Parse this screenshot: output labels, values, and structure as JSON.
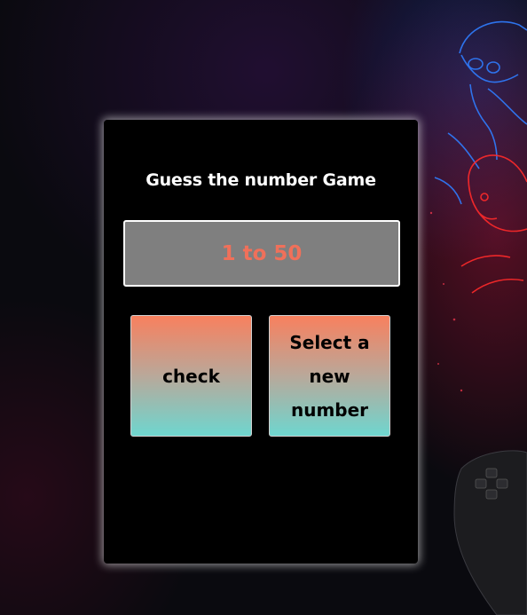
{
  "game": {
    "title": "Guess the number Game",
    "range_text": "1 to 50",
    "check_label": "check",
    "new_number_label": "Select a new number"
  },
  "colors": {
    "card_background": "#000000",
    "range_box_background": "#7f7f7f",
    "range_text": "#f0705a",
    "button_gradient_top": "#f8805e",
    "button_gradient_bottom": "#6ed6cf"
  },
  "background": {
    "description_icons": [
      "neon-soldier-icon",
      "neon-face-icon",
      "gamepad-icon"
    ]
  }
}
